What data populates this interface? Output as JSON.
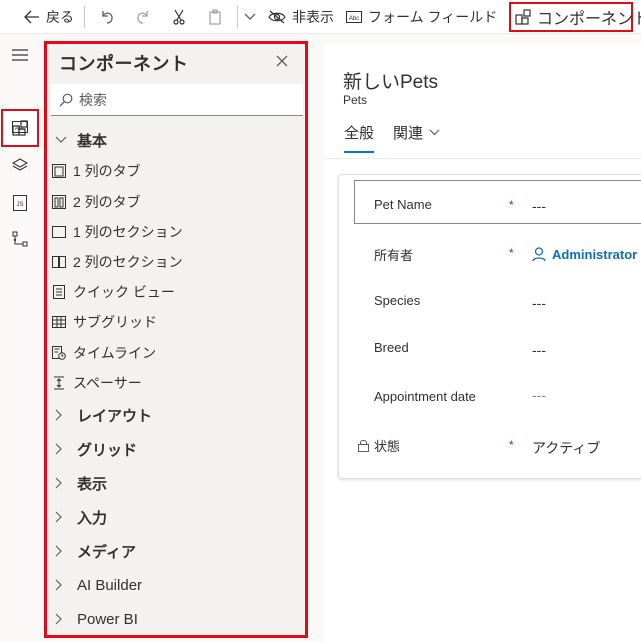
{
  "toolbar": {
    "back_label": "戻る",
    "hide_label": "非表示",
    "form_field_label": "フォーム フィールド",
    "components_label": "コンポーネント"
  },
  "panel": {
    "title": "コンポーネント",
    "search_placeholder": "検索",
    "basic_group": "基本",
    "basic_items": [
      {
        "label": "1 列のタブ",
        "icon": "one-column-tab-icon"
      },
      {
        "label": "2 列のタブ",
        "icon": "two-column-tab-icon"
      },
      {
        "label": "1 列のセクション",
        "icon": "one-column-section-icon"
      },
      {
        "label": "2 列のセクション",
        "icon": "two-column-section-icon"
      },
      {
        "label": "クイック ビュー",
        "icon": "quick-view-icon"
      },
      {
        "label": "サブグリッド",
        "icon": "subgrid-icon"
      },
      {
        "label": "タイムライン",
        "icon": "timeline-icon"
      },
      {
        "label": "スペーサー",
        "icon": "spacer-icon"
      }
    ],
    "groups": [
      "レイアウト",
      "グリッド",
      "表示",
      "入力",
      "メディア",
      "AI Builder",
      "Power BI"
    ]
  },
  "form": {
    "title": "新しいPets",
    "subtitle": "Pets",
    "tabs": [
      "全般",
      "関連"
    ],
    "fields": [
      {
        "label": "Pet Name",
        "required": "*",
        "value": "---"
      },
      {
        "label": "所有者",
        "required": "*",
        "value": "Administrator S"
      },
      {
        "label": "Species",
        "required": "",
        "value": "---"
      },
      {
        "label": "Breed",
        "required": "",
        "value": "---"
      },
      {
        "label": "Appointment date",
        "required": "",
        "value": "---"
      },
      {
        "label": "状態",
        "required": "*",
        "value": "アクティブ"
      }
    ]
  },
  "colors": {
    "highlight": "#e30a17",
    "accent": "#0078d4",
    "link": "#0f6cbd",
    "required": "#a4262c"
  }
}
